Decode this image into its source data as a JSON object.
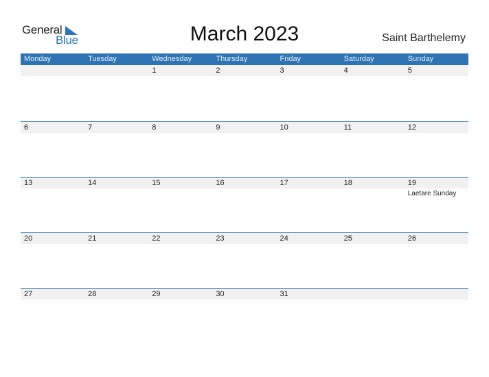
{
  "brand": {
    "general": "General",
    "blue": "Blue",
    "accent": "#2e74b5"
  },
  "title": "March 2023",
  "country": "Saint Barthelemy",
  "weekdays": [
    "Monday",
    "Tuesday",
    "Wednesday",
    "Thursday",
    "Friday",
    "Saturday",
    "Sunday"
  ],
  "weeks": [
    [
      {
        "d": ""
      },
      {
        "d": ""
      },
      {
        "d": "1"
      },
      {
        "d": "2"
      },
      {
        "d": "3"
      },
      {
        "d": "4"
      },
      {
        "d": "5"
      }
    ],
    [
      {
        "d": "6"
      },
      {
        "d": "7"
      },
      {
        "d": "8"
      },
      {
        "d": "9"
      },
      {
        "d": "10"
      },
      {
        "d": "11"
      },
      {
        "d": "12"
      }
    ],
    [
      {
        "d": "13"
      },
      {
        "d": "14"
      },
      {
        "d": "15"
      },
      {
        "d": "16"
      },
      {
        "d": "17"
      },
      {
        "d": "18"
      },
      {
        "d": "19",
        "event": "Laetare Sunday"
      }
    ],
    [
      {
        "d": "20"
      },
      {
        "d": "21"
      },
      {
        "d": "22"
      },
      {
        "d": "23"
      },
      {
        "d": "24"
      },
      {
        "d": "25"
      },
      {
        "d": "26"
      }
    ],
    [
      {
        "d": "27"
      },
      {
        "d": "28"
      },
      {
        "d": "29"
      },
      {
        "d": "30"
      },
      {
        "d": "31"
      },
      {
        "d": ""
      },
      {
        "d": ""
      }
    ]
  ]
}
